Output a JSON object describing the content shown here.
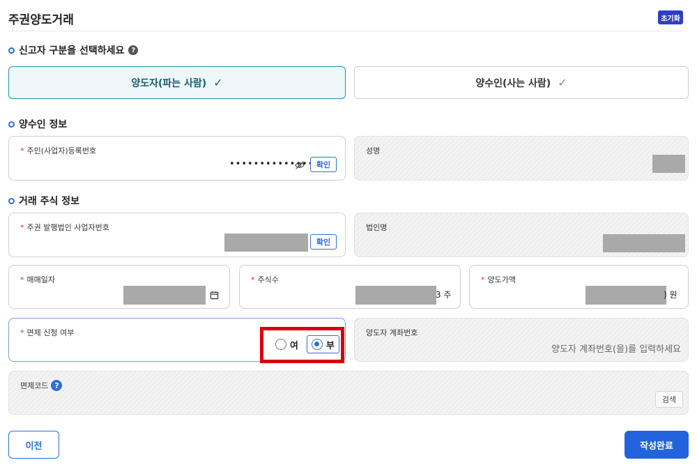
{
  "header": {
    "title": "주권양도거래",
    "reset_label": "초기화"
  },
  "section_reporter": {
    "title": "신고자 구분을 선택하세요",
    "help_glyph": "?"
  },
  "reporter_toggle": {
    "seller_label": "양도자(파는 사람)",
    "buyer_label": "양수인(사는 사람)",
    "selected": "seller"
  },
  "section_buyer": {
    "title": "양수인 정보"
  },
  "buyer": {
    "id_label": "주민(사업자)등록번호",
    "id_value": "••••••••••••••",
    "confirm_label": "확인",
    "name_label": "성명"
  },
  "section_stock": {
    "title": "거래 주식 정보"
  },
  "stock": {
    "issuer_label": "주권 발행법인 사업자번호",
    "confirm_label": "확인",
    "corp_name_label": "법인명",
    "date_label": "매매일자",
    "shares_label": "주식수",
    "shares_suffix": "3 주",
    "price_label": "양도가액",
    "price_suffix": ") 원",
    "exemption_label": "면제 신청 여부",
    "exemption_yes": "여",
    "exemption_no": "부",
    "exemption_selected": "no",
    "account_label": "양도자 계좌번호",
    "account_placeholder": "양도자 계좌번호(을)를 입력하세요",
    "exemption_code_label": "면제코드",
    "search_label": "검색"
  },
  "footer": {
    "prev_label": "이전",
    "submit_label": "작성완료"
  },
  "required_mark": "*",
  "colors": {
    "accent": "#2262dc",
    "highlight": "#d8000c",
    "active_toggle_border": "#2a8ea8"
  },
  "icons": {
    "check": "checkmark-icon",
    "eye": "eye-slash-icon",
    "calendar": "calendar-icon",
    "help": "question-icon"
  }
}
